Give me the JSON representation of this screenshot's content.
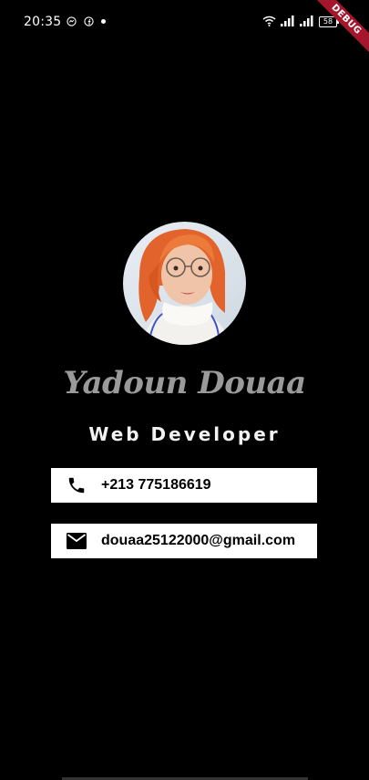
{
  "status_bar": {
    "time": "20:35",
    "battery": "58"
  },
  "debug_ribbon": "DEBUG",
  "profile": {
    "name": "Yadoun Douaa",
    "title": "Web Developer"
  },
  "contacts": [
    {
      "icon": "phone-icon",
      "value": "+213 775186619"
    },
    {
      "icon": "email-icon",
      "value": "douaa25122000@gmail.com"
    }
  ],
  "colors": {
    "background": "#000000",
    "name_color": "#9a9a9a",
    "card_background": "#ffffff",
    "debug_ribbon": "#a3162c"
  }
}
